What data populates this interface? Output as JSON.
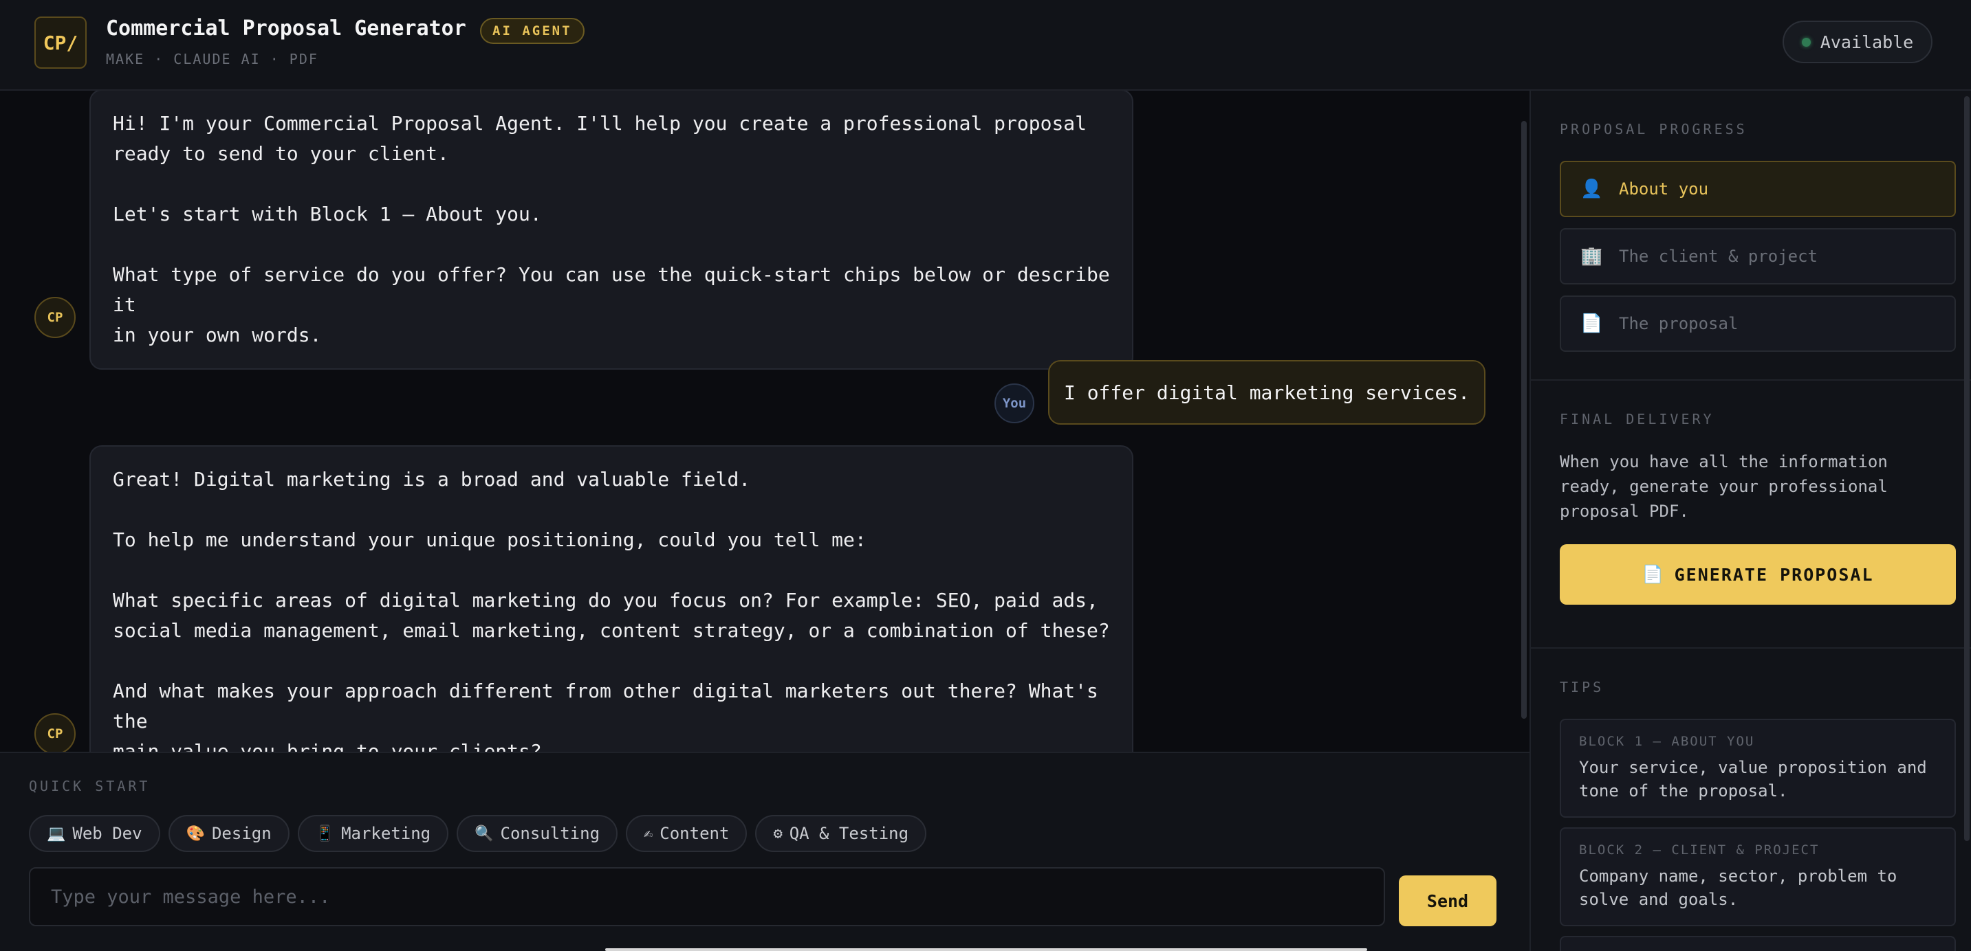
{
  "header": {
    "logo": "CP/",
    "title": "Commercial Proposal Generator",
    "badge": "AI AGENT",
    "subtitle": "MAKE · CLAUDE AI · PDF",
    "status": "Available"
  },
  "chat": {
    "bot_avatar": "CP",
    "user_avatar": "You",
    "messages": [
      {
        "role": "bot",
        "paragraphs": [
          "Hi! I'm your Commercial Proposal Agent. I'll help you create a professional proposal\nready to send to your client.",
          "Let's start with Block 1 — About you.",
          "What type of service do you offer? You can use the quick-start chips below or describe it\nin your own words."
        ]
      },
      {
        "role": "user",
        "text": "I offer digital marketing services."
      },
      {
        "role": "bot",
        "paragraphs": [
          "Great! Digital marketing is a broad and valuable field.",
          "To help me understand your unique positioning, could you tell me:",
          "What specific areas of digital marketing do you focus on? For example: SEO, paid ads,\nsocial media management, email marketing, content strategy, or a combination of these?",
          "And what makes your approach different from other digital marketers out there? What's the\nmain value you bring to your clients?"
        ]
      }
    ]
  },
  "composer": {
    "quick_start_label": "QUICK START",
    "chips": [
      {
        "icon": "💻",
        "icon_name": "laptop-icon",
        "label": "Web Dev"
      },
      {
        "icon": "🎨",
        "icon_name": "palette-icon",
        "label": "Design"
      },
      {
        "icon": "📱",
        "icon_name": "phone-icon",
        "label": "Marketing"
      },
      {
        "icon": "🔍",
        "icon_name": "magnifier-icon",
        "label": "Consulting"
      },
      {
        "icon": "✍",
        "icon_name": "writing-hand-icon",
        "label": "Content"
      },
      {
        "icon": "⚙",
        "icon_name": "gear-icon",
        "label": "QA & Testing"
      }
    ],
    "input_placeholder": "Type your message here...",
    "send_label": "Send"
  },
  "sidebar": {
    "progress_label": "PROPOSAL PROGRESS",
    "steps": [
      {
        "icon": "👤",
        "icon_name": "person-icon",
        "label": "About you",
        "active": true
      },
      {
        "icon": "🏢",
        "icon_name": "building-icon",
        "label": "The client & project",
        "active": false
      },
      {
        "icon": "📄",
        "icon_name": "document-icon",
        "label": "The proposal",
        "active": false
      }
    ],
    "delivery_label": "FINAL DELIVERY",
    "delivery_text": "When you have all the information ready, generate your professional proposal PDF.",
    "generate_icon": "📄",
    "generate_label": "GENERATE PROPOSAL",
    "tips_label": "TIPS",
    "tips": [
      {
        "title": "BLOCK 1 — ABOUT YOU",
        "text": "Your service, value proposition and tone of the proposal."
      },
      {
        "title": "BLOCK 2 — CLIENT & PROJECT",
        "text": "Company name, sector, problem to solve and goals."
      }
    ]
  },
  "colors": {
    "accent": "#efc95c",
    "background": "#0b0c10",
    "panel": "#111318",
    "status_dot": "#2f7a53"
  }
}
